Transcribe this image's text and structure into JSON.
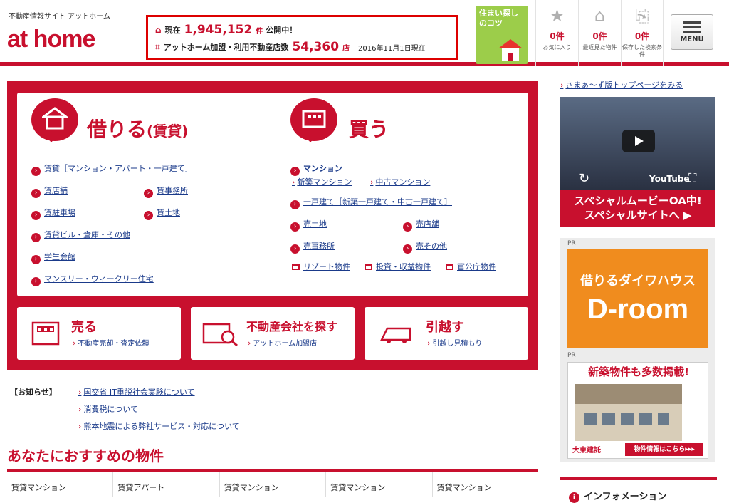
{
  "header": {
    "logo_sub": "不動産情報サイト アットホーム",
    "logo": "at home",
    "stats": {
      "row1_prefix": "現在",
      "listing_count": "1,945,152",
      "row1_unit": "件",
      "row1_suffix": "公開中！",
      "row2_prefix": "アットホーム加盟・利用不動産店数",
      "store_count": "54,360",
      "row2_unit": "店",
      "date": "2016年11月1日現在"
    },
    "tips_label": "住まい探しのコツ",
    "icons": [
      {
        "name": "favorites",
        "count": "0件",
        "label": "お気に入り",
        "icon": "star-icon"
      },
      {
        "name": "recently-viewed",
        "count": "0件",
        "label": "最近見た物件",
        "icon": "house-icon"
      },
      {
        "name": "saved-search",
        "count": "0件",
        "label": "保存した検索条件",
        "icon": "saved-search-icon"
      }
    ],
    "menu_label": "MENU"
  },
  "rent": {
    "title": "借りる",
    "title_sub": "(賃貸)",
    "links": {
      "all": "賃貸［マンション・アパート・一戸建て］",
      "store": "賃店舗",
      "office": "賃事務所",
      "parking": "賃駐車場",
      "land": "賃土地",
      "building": "賃貸ビル・倉庫・その他",
      "student": "学生会館",
      "monthly": "マンスリー・ウィークリー住宅"
    }
  },
  "buy": {
    "title": "買う",
    "links": {
      "mansion": "マンション",
      "new_mansion": "新築マンション",
      "used_mansion": "中古マンション",
      "house": "一戸建て［新築一戸建て・中古一戸建て］",
      "land": "売土地",
      "store": "売店舗",
      "office": "売事務所",
      "other": "売その他",
      "resort": "リゾート物件",
      "investment": "投資・収益物件",
      "public": "官公庁物件"
    }
  },
  "cards": {
    "sell": {
      "title": "売る",
      "link": "不動産売却・査定依頼"
    },
    "agency": {
      "title": "不動産会社を探す",
      "link": "アットホーム加盟店"
    },
    "move": {
      "title": "引越す",
      "link": "引越し見積もり"
    }
  },
  "notices": {
    "heading": "【お知らせ】",
    "items": [
      "国交省 IT重説社会実験について",
      "消費税について",
      "熊本地震による弊社サービス・対応について"
    ]
  },
  "recommend": {
    "title": "あなたにおすすめの物件",
    "items": [
      "賃貸マンション",
      "賃貸アパート",
      "賃貸マンション",
      "賃貸マンション",
      "賃貸マンション"
    ]
  },
  "sidebar": {
    "link": "さまぁ～ず版トップページをみる",
    "video_logo": "YouTube",
    "movie_banner_line1": "スペシャルムービーOA中!",
    "movie_banner_line2": "スペシャルサイトへ ▶",
    "pr_label": "PR",
    "ad1_line1": "借りるダイワハウス",
    "ad1_line2": "D-room",
    "ad2_heading": "新築物件も多数掲載!",
    "ad2_brand": "大東建託",
    "ad2_button": "物件情報はこちら▸▸▸",
    "info_heading": "インフォメーション"
  },
  "colors": {
    "brand": "#c8102e",
    "link": "#1a3a8a",
    "tips": "#9ccd4a",
    "droom": "#f08c1e"
  }
}
